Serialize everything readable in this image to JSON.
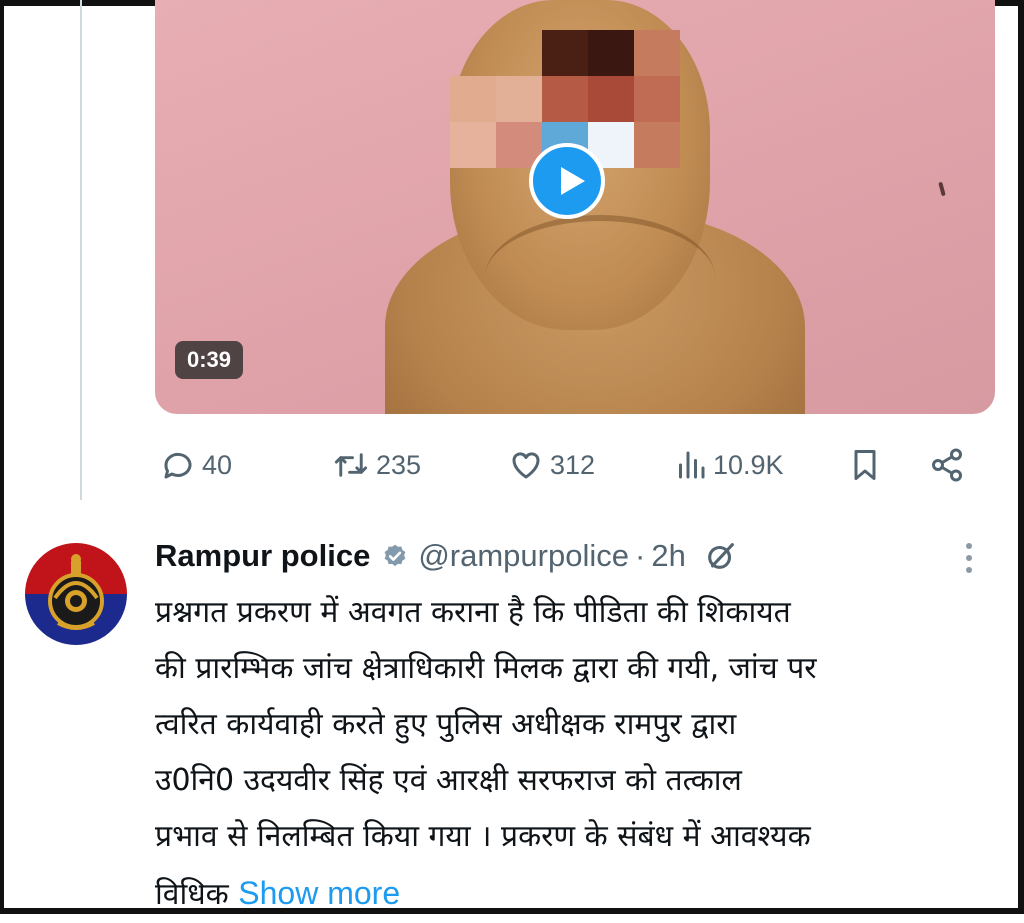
{
  "video": {
    "duration": "0:39",
    "play_icon": "play-icon"
  },
  "actions": {
    "replies": "40",
    "reposts": "235",
    "likes": "312",
    "views": "10.9K",
    "icons": [
      "reply-icon",
      "repost-icon",
      "like-icon",
      "views-icon",
      "bookmark-icon",
      "share-icon"
    ]
  },
  "tweet": {
    "author_name": "Rampur police",
    "handle": "@rampurpolice",
    "separator": "·",
    "time": "2h",
    "body_lines": [
      "प्रश्नगत प्रकरण में अवगत कराना है कि पीडिता की शिकायत",
      "की प्रारम्भिक जांच क्षेत्राधिकारी मिलक द्वारा की गयी, जांच पर",
      "त्वरित कार्यवाही करते हुए पुलिस अधीक्षक रामपुर द्वारा",
      "उ0नि0 उदयवीर सिंह एवं आरक्षी सरफराज को तत्काल",
      "प्रभाव से निलम्बित किया गया । प्रकरण के संबंध में आवश्यक",
      "विधिक"
    ],
    "show_more": "Show more"
  },
  "colors": {
    "accent": "#1d9bf0",
    "secondary_text": "#536471",
    "primary_text": "#0f1419"
  }
}
